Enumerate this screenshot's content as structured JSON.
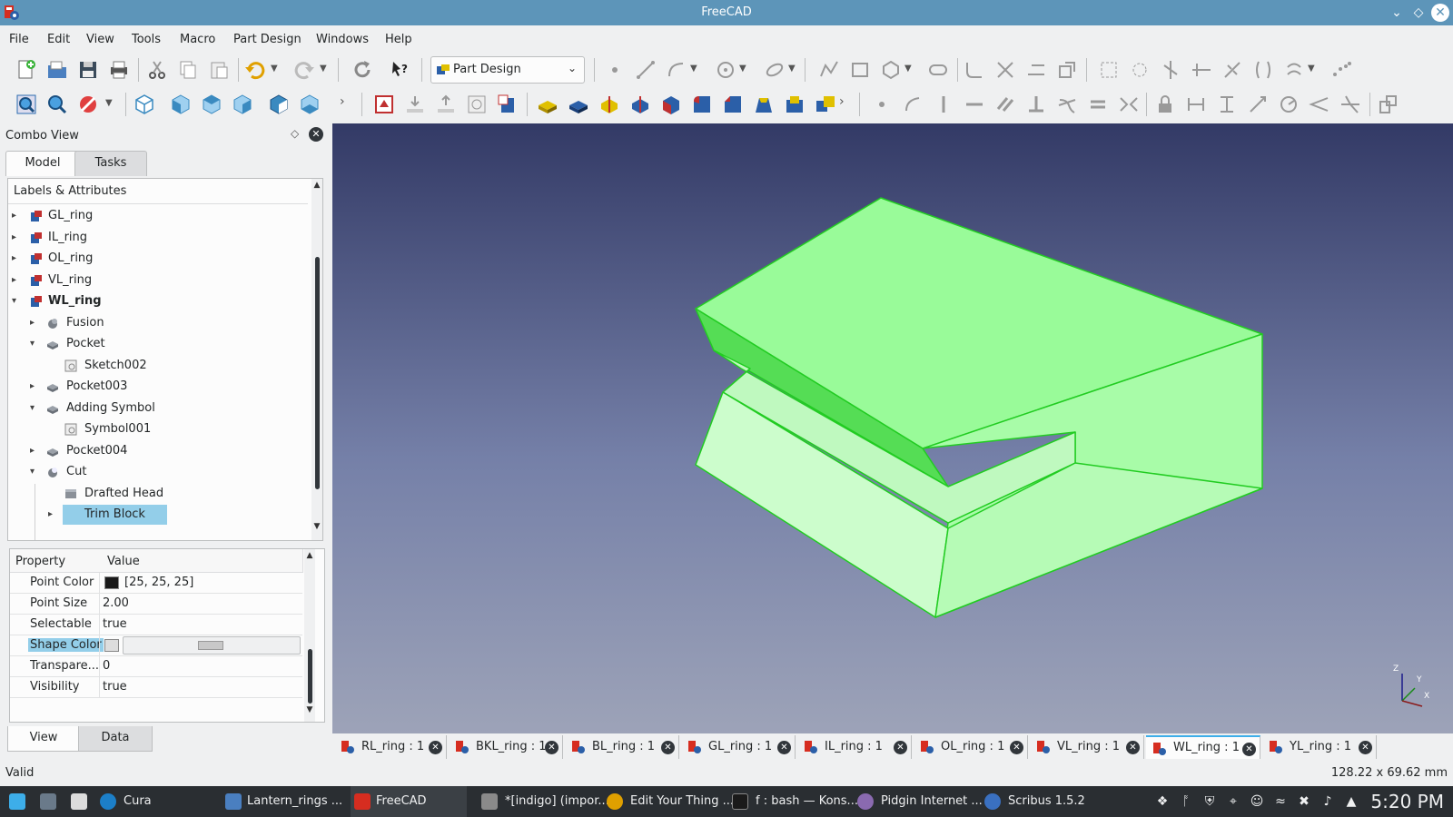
{
  "window": {
    "title": "FreeCAD"
  },
  "menu": [
    "File",
    "Edit",
    "View",
    "Tools",
    "Macro",
    "Part Design",
    "Windows",
    "Help"
  ],
  "workbench": {
    "selected": "Part Design"
  },
  "combo": {
    "title": "Combo View",
    "tabs": [
      "Model",
      "Tasks"
    ],
    "tree_header": "Labels & Attributes",
    "tree": [
      {
        "label": "GL_ring"
      },
      {
        "label": "IL_ring"
      },
      {
        "label": "OL_ring"
      },
      {
        "label": "VL_ring"
      },
      {
        "label": "WL_ring"
      },
      {
        "label": "Fusion"
      },
      {
        "label": "Pocket"
      },
      {
        "label": "Sketch002"
      },
      {
        "label": "Pocket003"
      },
      {
        "label": "Adding Symbol"
      },
      {
        "label": "Symbol001"
      },
      {
        "label": "Pocket004"
      },
      {
        "label": "Cut"
      },
      {
        "label": "Drafted Head"
      },
      {
        "label": "Trim Block"
      }
    ]
  },
  "properties": {
    "headers": [
      "Property",
      "Value"
    ],
    "rows": [
      {
        "name": "Point Color",
        "value": "[25, 25, 25]"
      },
      {
        "name": "Point Size",
        "value": "2.00"
      },
      {
        "name": "Selectable",
        "value": "true"
      },
      {
        "name": "Shape Color",
        "value": ""
      },
      {
        "name": "Transpare...",
        "value": "0"
      },
      {
        "name": "Visibility",
        "value": "true"
      }
    ],
    "tabs": [
      "View",
      "Data"
    ]
  },
  "doc_tabs": [
    {
      "label": "RL_ring : 1"
    },
    {
      "label": "BKL_ring : 1"
    },
    {
      "label": "BL_ring : 1"
    },
    {
      "label": "GL_ring : 1"
    },
    {
      "label": "IL_ring : 1"
    },
    {
      "label": "OL_ring : 1"
    },
    {
      "label": "VL_ring : 1"
    },
    {
      "label": "WL_ring : 1"
    },
    {
      "label": "YL_ring : 1"
    }
  ],
  "status": {
    "left": "Valid",
    "right": "128.22 x 69.62 mm"
  },
  "taskbar": {
    "items": [
      {
        "label": "Cura"
      },
      {
        "label": "Lantern_rings ..."
      },
      {
        "label": "FreeCAD"
      },
      {
        "label": "*[indigo] (impor..."
      },
      {
        "label": "Edit Your Thing ..."
      },
      {
        "label": "f : bash — Kons..."
      },
      {
        "label": "Pidgin Internet ..."
      },
      {
        "label": "Scribus 1.5.2"
      }
    ],
    "clock": "5:20 PM"
  },
  "axis": {
    "z": "Z",
    "y": "Y",
    "x": "X"
  },
  "colors": {
    "shape": "#99ff99",
    "edge": "#22cc22",
    "accent": "#3daee9"
  }
}
